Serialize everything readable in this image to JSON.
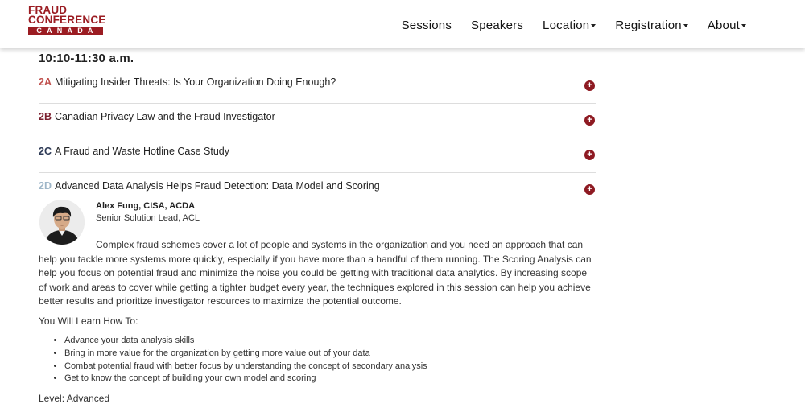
{
  "header": {
    "logo": {
      "line1": "FRAUD",
      "line2": "CONFERENCE",
      "line3": "CANADA"
    },
    "nav": [
      {
        "label": "Sessions"
      },
      {
        "label": "Speakers"
      },
      {
        "label": "Location"
      },
      {
        "label": "Registration"
      },
      {
        "label": "About"
      }
    ]
  },
  "time_slot": "10:10-11:30 a.m.",
  "sessions": [
    {
      "code": "2A",
      "title": "Mitigating Insider Threats: Is Your Organization Doing Enough?",
      "code_color": "#c0504d"
    },
    {
      "code": "2B",
      "title": "Canadian Privacy Law and the Fraud Investigator",
      "code_color": "#7b1f2e"
    },
    {
      "code": "2C",
      "title": "A Fraud and Waste Hotline Case Study",
      "code_color": "#2d3a56"
    },
    {
      "code": "2D",
      "title": "Advanced Data Analysis Helps Fraud Detection: Data Model and Scoring",
      "code_color": "#9eb6c8"
    }
  ],
  "expanded": {
    "speaker_name": "Alex Fung, CISA, ACDA",
    "speaker_role": "Senior Solution Lead, ACL",
    "description": "Complex fraud schemes cover a lot of people and systems in the organization and you need an approach that can help you tackle more systems more quickly, especially if you have more than a handful of them running. The Scoring Analysis can help you focus on potential fraud and minimize the noise you could be getting with traditional data analytics. By increasing scope of work and areas to cover while getting a tighter budget every year, the techniques explored in this session can help you achieve better results and prioritize investigator resources to maximize the potential outcome.",
    "learn_heading": "You Will Learn How To:",
    "learn_items": [
      "Advance your data analysis skills",
      "Bring in more value for the organization by getting more value out of your data",
      "Combat potential fraud with better focus by understanding the concept of secondary analysis",
      "Get to know the concept of building your own model and scoring"
    ],
    "level": "Level: Advanced"
  },
  "colors": {
    "brand": "#9b1c22",
    "expand_button": "#8e1a22"
  },
  "icons": {
    "expand": "plus-circle-icon",
    "dropdown": "caret-down-icon"
  }
}
